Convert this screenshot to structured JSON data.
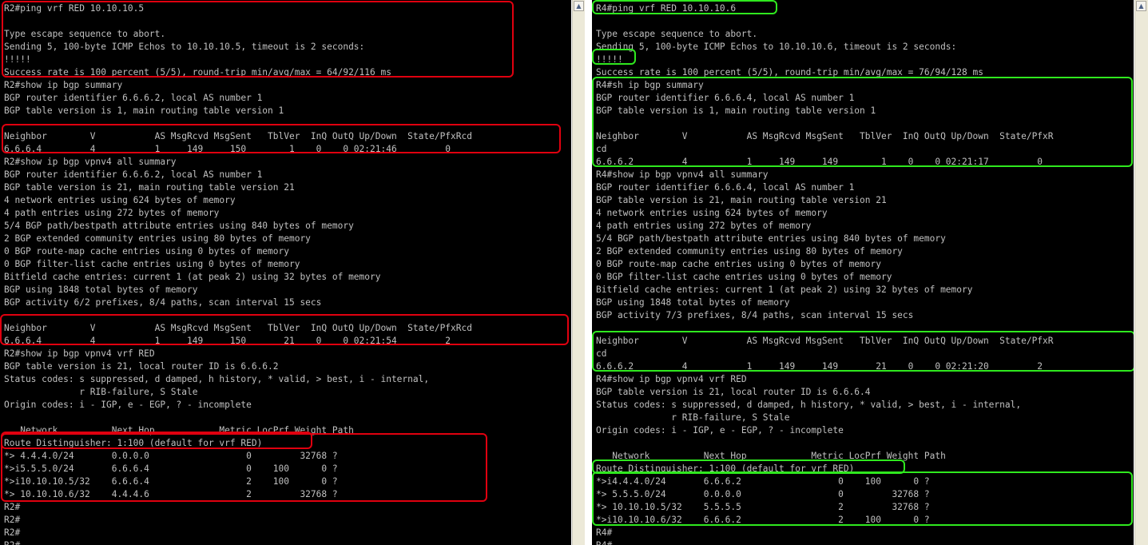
{
  "left_terminal": {
    "lines": [
      "R2#ping vrf RED 10.10.10.5",
      "",
      "Type escape sequence to abort.",
      "Sending 5, 100-byte ICMP Echos to 10.10.10.5, timeout is 2 seconds:",
      "!!!!!",
      "Success rate is 100 percent (5/5), round-trip min/avg/max = 64/92/116 ms",
      "R2#show ip bgp summary",
      "BGP router identifier 6.6.6.2, local AS number 1",
      "BGP table version is 1, main routing table version 1",
      "",
      "Neighbor        V           AS MsgRcvd MsgSent   TblVer  InQ OutQ Up/Down  State/PfxRcd",
      "6.6.6.4         4           1     149     150        1    0    0 02:21:46         0",
      "R2#show ip bgp vpnv4 all summary",
      "BGP router identifier 6.6.6.2, local AS number 1",
      "BGP table version is 21, main routing table version 21",
      "4 network entries using 624 bytes of memory",
      "4 path entries using 272 bytes of memory",
      "5/4 BGP path/bestpath attribute entries using 840 bytes of memory",
      "2 BGP extended community entries using 80 bytes of memory",
      "0 BGP route-map cache entries using 0 bytes of memory",
      "0 BGP filter-list cache entries using 0 bytes of memory",
      "Bitfield cache entries: current 1 (at peak 2) using 32 bytes of memory",
      "BGP using 1848 total bytes of memory",
      "BGP activity 6/2 prefixes, 8/4 paths, scan interval 15 secs",
      "",
      "Neighbor        V           AS MsgRcvd MsgSent   TblVer  InQ OutQ Up/Down  State/PfxRcd",
      "6.6.6.4         4           1     149     150       21    0    0 02:21:54         2",
      "R2#show ip bgp vpnv4 vrf RED",
      "BGP table version is 21, local router ID is 6.6.6.2",
      "Status codes: s suppressed, d damped, h history, * valid, > best, i - internal,",
      "              r RIB-failure, S Stale",
      "Origin codes: i - IGP, e - EGP, ? - incomplete",
      "",
      "   Network          Next Hop            Metric LocPrf Weight Path",
      "Route Distinguisher: 1:100 (default for vrf RED)",
      "*> 4.4.4.0/24       0.0.0.0                  0         32768 ?",
      "*>i5.5.5.0/24       6.6.6.4                  0    100      0 ?",
      "*>i10.10.10.5/32    6.6.6.4                  2    100      0 ?",
      "*> 10.10.10.6/32    4.4.4.6                  2         32768 ?",
      "R2#",
      "R2#",
      "R2#",
      "R2#"
    ]
  },
  "right_terminal": {
    "lines": [
      "R4#ping vrf RED 10.10.10.6",
      "",
      "Type escape sequence to abort.",
      "Sending 5, 100-byte ICMP Echos to 10.10.10.6, timeout is 2 seconds:",
      "!!!!!",
      "Success rate is 100 percent (5/5), round-trip min/avg/max = 76/94/128 ms",
      "R4#sh ip bgp summary",
      "BGP router identifier 6.6.6.4, local AS number 1",
      "BGP table version is 1, main routing table version 1",
      "",
      "Neighbor        V           AS MsgRcvd MsgSent   TblVer  InQ OutQ Up/Down  State/PfxR",
      "cd",
      "6.6.6.2         4           1     149     149        1    0    0 02:21:17         0",
      "R4#show ip bgp vpnv4 all summary",
      "BGP router identifier 6.6.6.4, local AS number 1",
      "BGP table version is 21, main routing table version 21",
      "4 network entries using 624 bytes of memory",
      "4 path entries using 272 bytes of memory",
      "5/4 BGP path/bestpath attribute entries using 840 bytes of memory",
      "2 BGP extended community entries using 80 bytes of memory",
      "0 BGP route-map cache entries using 0 bytes of memory",
      "0 BGP filter-list cache entries using 0 bytes of memory",
      "Bitfield cache entries: current 1 (at peak 2) using 32 bytes of memory",
      "BGP using 1848 total bytes of memory",
      "BGP activity 7/3 prefixes, 8/4 paths, scan interval 15 secs",
      "",
      "Neighbor        V           AS MsgRcvd MsgSent   TblVer  InQ OutQ Up/Down  State/PfxR",
      "cd",
      "6.6.6.2         4           1     149     149       21    0    0 02:21:20         2",
      "R4#show ip bgp vpnv4 vrf RED",
      "BGP table version is 21, local router ID is 6.6.6.4",
      "Status codes: s suppressed, d damped, h history, * valid, > best, i - internal,",
      "              r RIB-failure, S Stale",
      "Origin codes: i - IGP, e - EGP, ? - incomplete",
      "",
      "   Network          Next Hop            Metric LocPrf Weight Path",
      "Route Distinguisher: 1:100 (default for vrf RED)",
      "*>i4.4.4.0/24       6.6.6.2                  0    100      0 ?",
      "*> 5.5.5.0/24       0.0.0.0                  0         32768 ?",
      "*> 10.10.10.5/32    5.5.5.5                  2         32768 ?",
      "*>i10.10.10.6/32    6.6.6.2                  2    100      0 ?",
      "R4#",
      "R4#"
    ]
  },
  "colors": {
    "terminal_bg": "#000000",
    "terminal_fg": "#c0c0c0",
    "highlight_left": "#e0000f",
    "highlight_right": "#2fe81e",
    "scrollbar": "#ece9d8"
  },
  "icons": {
    "scroll_up": "▲"
  }
}
